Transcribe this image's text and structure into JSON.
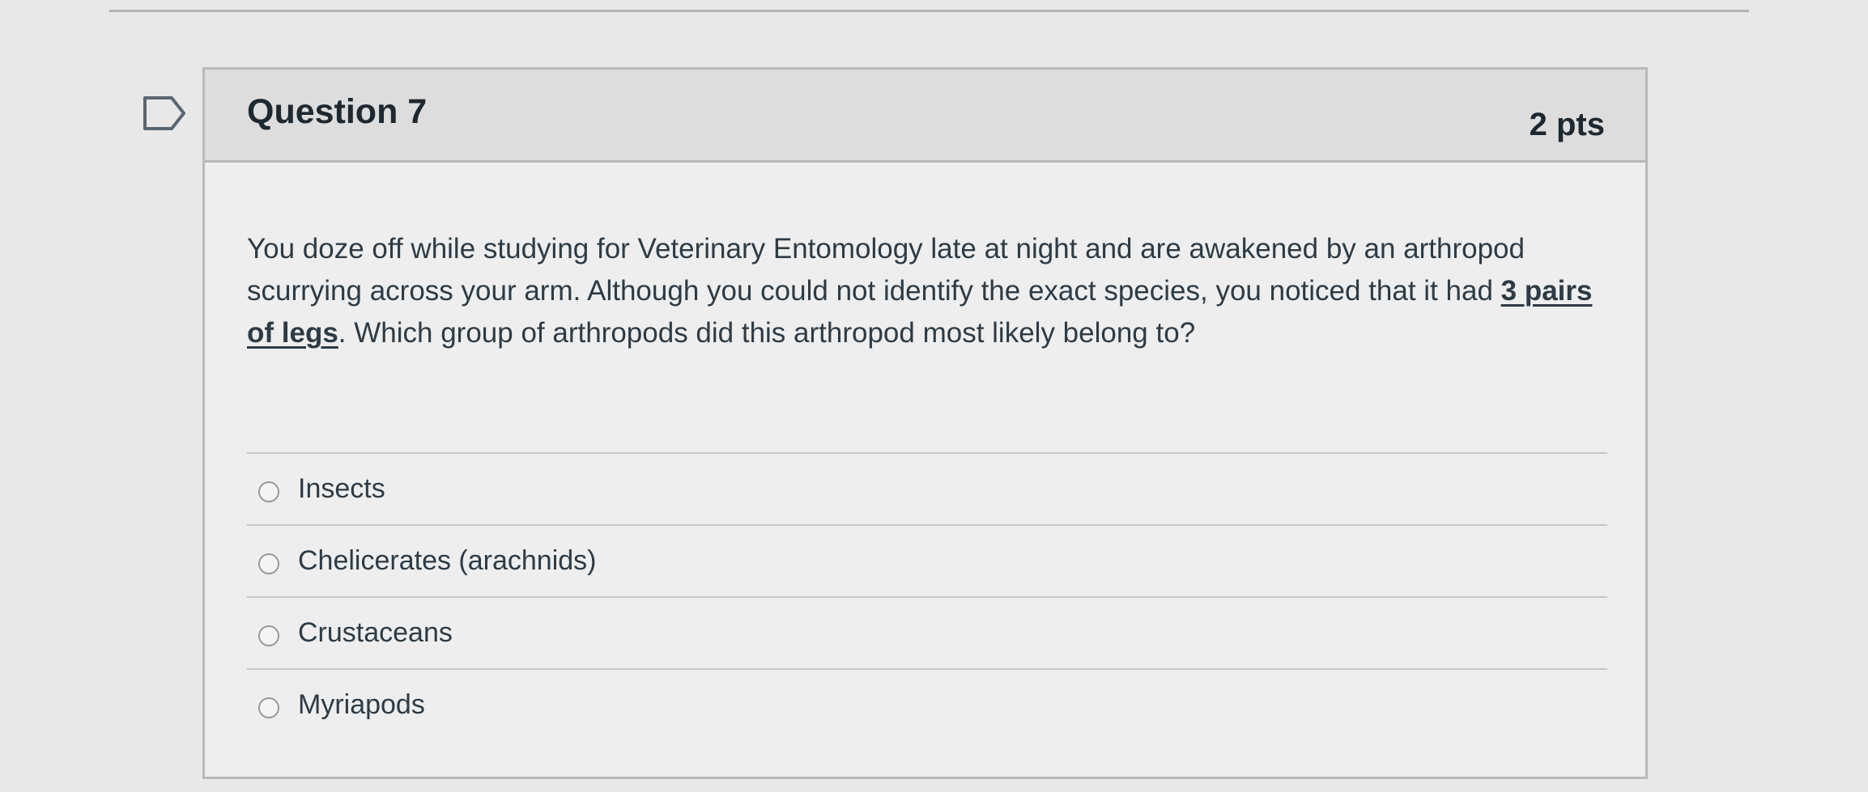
{
  "question": {
    "title": "Question 7",
    "points": "2 pts",
    "text_before": "You doze off while studying for Veterinary Entomology late at night and are awakened by an arthropod scurrying across your arm.  Although you could not identify the exact species, you noticed that it had ",
    "text_emphasis": "3 pairs of legs",
    "text_after": ".  Which group of arthropods did this arthropod most likely belong to?",
    "flag_icon": "flag-outline-icon"
  },
  "answers": [
    {
      "label": "Insects",
      "selected": false
    },
    {
      "label": "Chelicerates (arachnids)",
      "selected": false
    },
    {
      "label": "Crustaceans",
      "selected": false
    },
    {
      "label": "Myriapods",
      "selected": false
    }
  ],
  "colors": {
    "page_bg": "#e8e8e8",
    "card_bg": "#eeeeee",
    "header_bg": "#dddddd",
    "border": "#b9b9b9",
    "text": "#2d3b45"
  }
}
